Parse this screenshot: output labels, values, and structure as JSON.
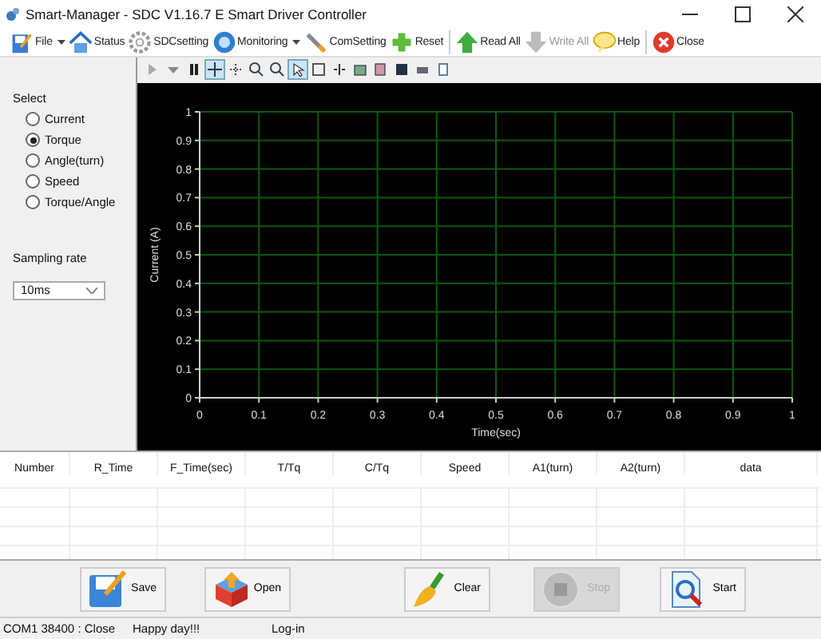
{
  "window": {
    "title": "Smart-Manager - SDC  V1.16.7 E  Smart Driver Controller"
  },
  "toolbar": [
    {
      "label": "File",
      "dropdown": true,
      "disabled": false,
      "separator_after": false
    },
    {
      "label": "Status",
      "dropdown": false,
      "disabled": false,
      "separator_after": false
    },
    {
      "label": "SDCsetting",
      "dropdown": false,
      "disabled": false,
      "separator_after": false
    },
    {
      "label": "Monitoring",
      "dropdown": true,
      "disabled": false,
      "separator_after": false
    },
    {
      "label": "ComSetting",
      "dropdown": false,
      "disabled": false,
      "separator_after": false
    },
    {
      "label": "Reset",
      "dropdown": false,
      "disabled": false,
      "separator_after": true
    },
    {
      "label": "Read All",
      "dropdown": false,
      "disabled": false,
      "separator_after": false
    },
    {
      "label": "Write All",
      "dropdown": false,
      "disabled": true,
      "separator_after": false
    },
    {
      "label": "Help",
      "dropdown": false,
      "disabled": false,
      "separator_after": true
    },
    {
      "label": "Close",
      "dropdown": false,
      "disabled": false,
      "separator_after": false
    }
  ],
  "select": {
    "label": "Select",
    "options": [
      {
        "label": "Current",
        "selected": false
      },
      {
        "label": "Torque",
        "selected": true
      },
      {
        "label": "Angle(turn)",
        "selected": false
      },
      {
        "label": "Speed",
        "selected": false
      },
      {
        "label": "Torque/Angle",
        "selected": false
      }
    ]
  },
  "sampling_rate": {
    "label": "Sampling rate",
    "value": "10ms"
  },
  "chart_tools": [
    {
      "selected": false
    },
    {
      "selected": false
    },
    {
      "selected": false
    },
    {
      "selected": true
    },
    {
      "selected": false
    },
    {
      "selected": false
    },
    {
      "selected": false
    },
    {
      "selected": true
    },
    {
      "selected": false
    },
    {
      "selected": false
    },
    {
      "selected": false
    },
    {
      "selected": false
    },
    {
      "selected": false
    },
    {
      "selected": false
    },
    {
      "selected": false
    }
  ],
  "chart": {
    "chart_data": {
      "type": "line",
      "grid": true,
      "xlabel": "Time(sec)",
      "ylabel": "Current (A)",
      "xlim": [
        0,
        1
      ],
      "ylim": [
        0,
        1
      ],
      "xticks": [
        0,
        0.1,
        0.2,
        0.3,
        0.4,
        0.5,
        0.6,
        0.7,
        0.8,
        0.9,
        1
      ],
      "yticks": [
        0,
        0.1,
        0.2,
        0.3,
        0.4,
        0.5,
        0.6,
        0.7,
        0.8,
        0.9,
        1
      ]
    }
  },
  "table": {
    "columns": [
      "Number",
      "R_Time",
      "F_Time(sec)",
      "T/Tq",
      "C/Tq",
      "Speed",
      "A1(turn)",
      "A2(turn)",
      "data"
    ]
  },
  "buttons": [
    {
      "label": "Save",
      "disabled": false
    },
    {
      "label": "Open",
      "disabled": false
    },
    {
      "label": "Clear",
      "disabled": false
    },
    {
      "label": "Stop",
      "disabled": true
    },
    {
      "label": "Start",
      "disabled": false
    }
  ],
  "status_bar": [
    "COM1  38400 : Close",
    "Happy day!!!",
    "Log-in"
  ]
}
